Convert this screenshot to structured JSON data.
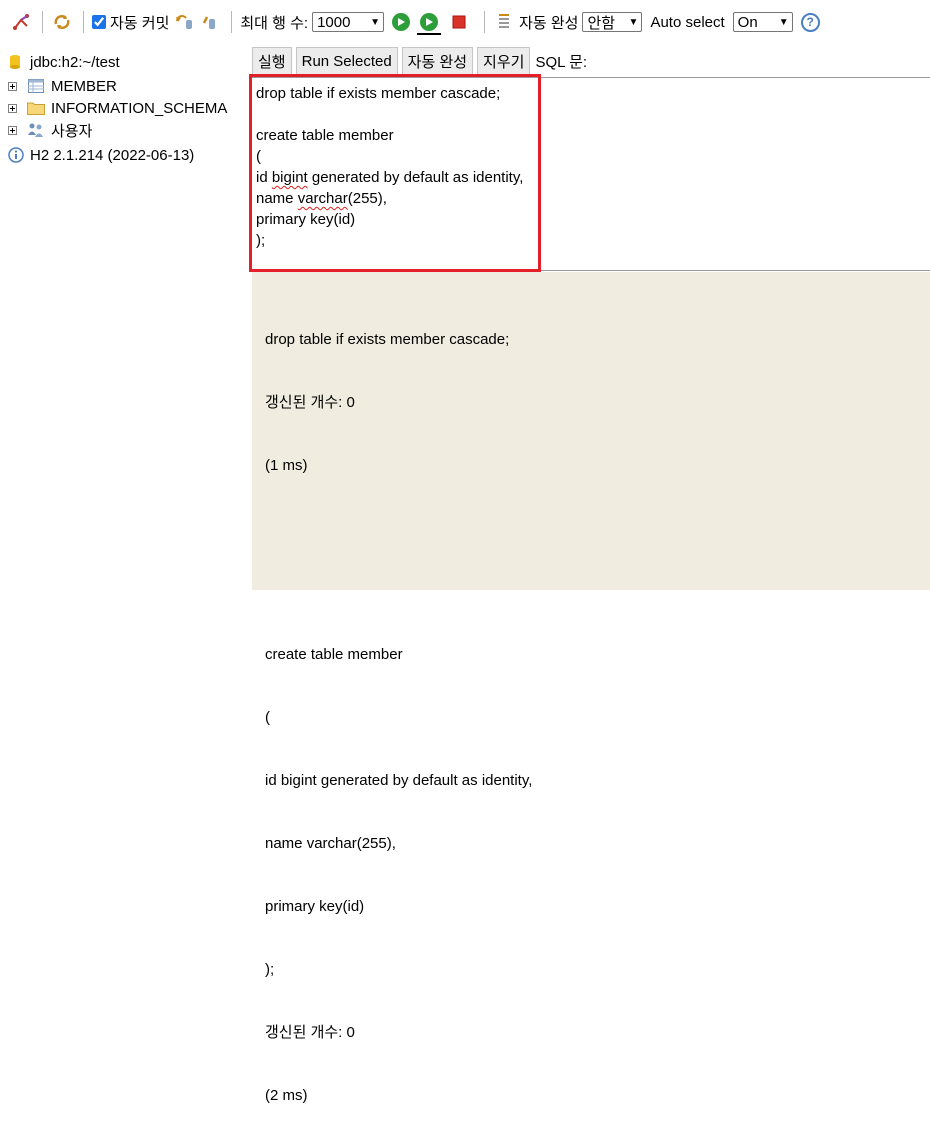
{
  "toolbar": {
    "autocommit_label": "자동 커밋",
    "autocommit_checked": true,
    "max_rows_label": "최대 행 수:",
    "max_rows_value": "1000",
    "autocomplete_label": "자동 완성",
    "autocomplete_value": "안함",
    "auto_select_label": "Auto select",
    "auto_select_value": "On",
    "help_glyph": "?"
  },
  "tree": {
    "connection": "jdbc:h2:~/test",
    "items": [
      {
        "label": "MEMBER",
        "icon": "table-icon"
      },
      {
        "label": "INFORMATION_SCHEMA",
        "icon": "folder-icon"
      },
      {
        "label": "사용자",
        "icon": "users-icon"
      }
    ],
    "version": "H2 2.1.214 (2022-06-13)"
  },
  "buttons": {
    "run": "실행",
    "run_selected": "Run Selected",
    "autocomplete": "자동 완성",
    "clear": "지우기",
    "sql_label": "SQL 문:"
  },
  "editor": {
    "lines": [
      "drop table if exists member cascade;",
      "",
      "create table member",
      "(",
      "id bigint generated by default as identity,",
      "name varchar(255),",
      "primary key(id)",
      ");"
    ]
  },
  "result": {
    "lines": [
      "drop table if exists member cascade;",
      "갱신된 개수: 0",
      "(1 ms)",
      "",
      "",
      "create table member",
      "(",
      "id bigint generated by default as identity,",
      "name varchar(255),",
      "primary key(id)",
      ");",
      "갱신된 개수: 0",
      "(2 ms)"
    ]
  },
  "colors": {
    "highlight": "#e3202a",
    "result_bg": "#f0ede0",
    "run_green": "#2e9e3a",
    "stop_red": "#d9322a"
  }
}
